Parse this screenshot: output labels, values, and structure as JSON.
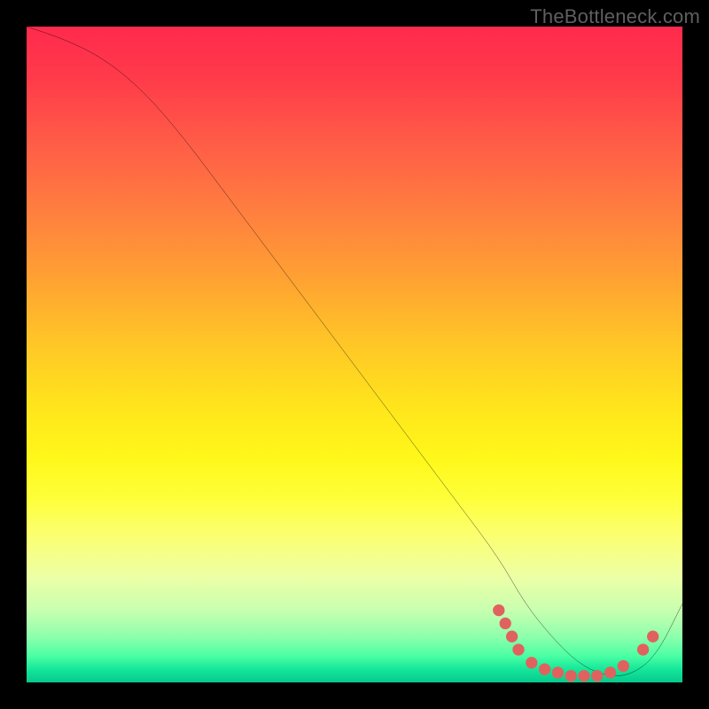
{
  "watermark": "TheBottleneck.com",
  "chart_data": {
    "type": "line",
    "title": "",
    "xlabel": "",
    "ylabel": "",
    "xlim": [
      0,
      100
    ],
    "ylim": [
      0,
      100
    ],
    "series": [
      {
        "name": "curve",
        "x": [
          0,
          6,
          12,
          18,
          24,
          30,
          36,
          42,
          48,
          54,
          60,
          66,
          72,
          76,
          80,
          84,
          88,
          92,
          96,
          100
        ],
        "y": [
          100,
          98,
          95,
          90,
          83,
          75,
          67,
          59,
          51,
          43,
          35,
          27,
          19,
          12,
          7,
          3,
          1,
          1,
          4,
          12
        ]
      }
    ],
    "markers": {
      "name": "dots",
      "color": "#e0625e",
      "points": [
        {
          "x": 72,
          "y": 11
        },
        {
          "x": 73,
          "y": 9
        },
        {
          "x": 74,
          "y": 7
        },
        {
          "x": 75,
          "y": 5
        },
        {
          "x": 77,
          "y": 3
        },
        {
          "x": 79,
          "y": 2
        },
        {
          "x": 81,
          "y": 1.5
        },
        {
          "x": 83,
          "y": 1
        },
        {
          "x": 85,
          "y": 1
        },
        {
          "x": 87,
          "y": 1
        },
        {
          "x": 89,
          "y": 1.5
        },
        {
          "x": 91,
          "y": 2.5
        },
        {
          "x": 94,
          "y": 5
        },
        {
          "x": 95.5,
          "y": 7
        }
      ]
    },
    "gradient_stops": [
      {
        "pos": 0.0,
        "color": "#ff2a4d"
      },
      {
        "pos": 0.5,
        "color": "#ffe51c"
      },
      {
        "pos": 0.9,
        "color": "#8effac"
      },
      {
        "pos": 1.0,
        "color": "#07c98d"
      }
    ]
  }
}
